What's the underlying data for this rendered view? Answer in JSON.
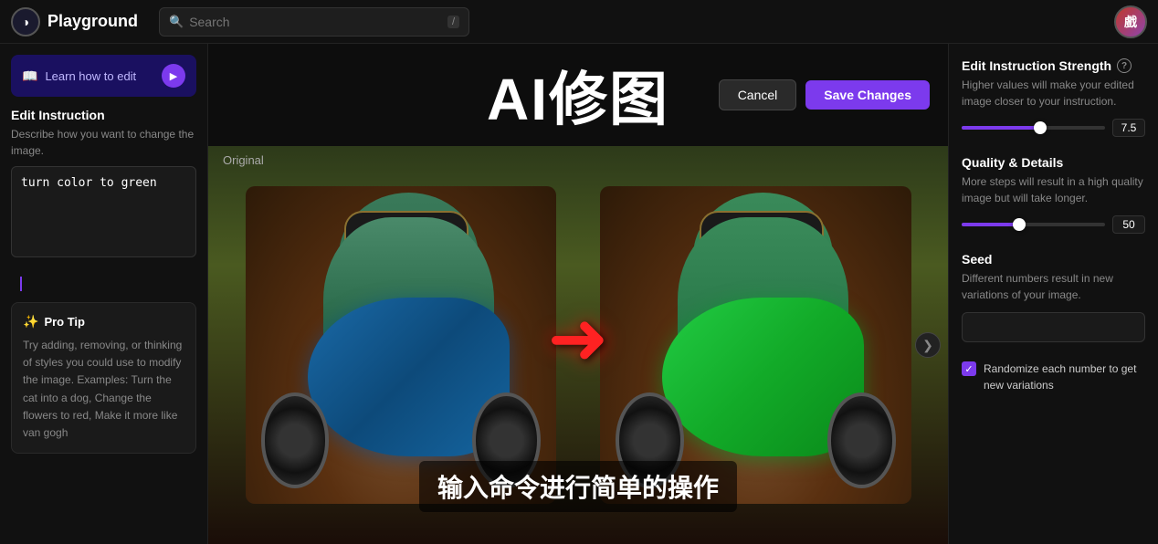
{
  "topbar": {
    "logo_text": "Playground",
    "logo_icon": "◑",
    "search_placeholder": "Search",
    "slash_key": "/",
    "avatar_text": "戲"
  },
  "left_sidebar": {
    "learn_banner_text": "Learn how to edit",
    "play_icon": "▶",
    "edit_instruction_title": "Edit Instruction",
    "edit_instruction_desc": "Describe how you want to change the image.",
    "edit_instruction_value": "turn color to green",
    "pro_tip_title": "Pro Tip",
    "pro_tip_body": "Try adding, removing, or thinking of styles you could use to modify the image. Examples: Turn the cat into a dog, Change the flowers to red, Make it more like van gogh"
  },
  "center": {
    "ai_title": "AI修图",
    "cancel_label": "Cancel",
    "save_label": "Save Changes",
    "original_label": "Original",
    "cn_subtitle": "输入命令进行简单的操作",
    "expand_icon": "❯"
  },
  "right_sidebar": {
    "strength_title": "Edit Instruction Strength",
    "strength_desc": "Higher values will make your edited image closer to your instruction.",
    "strength_value": "7.5",
    "strength_percent": 55,
    "quality_title": "Quality & Details",
    "quality_desc": "More steps will result in a high quality image but will take longer.",
    "quality_value": "50",
    "quality_percent": 40,
    "seed_title": "Seed",
    "seed_desc": "Different numbers result in new variations of your image.",
    "seed_placeholder": "",
    "randomize_label": "Randomize each number to get new variations"
  }
}
